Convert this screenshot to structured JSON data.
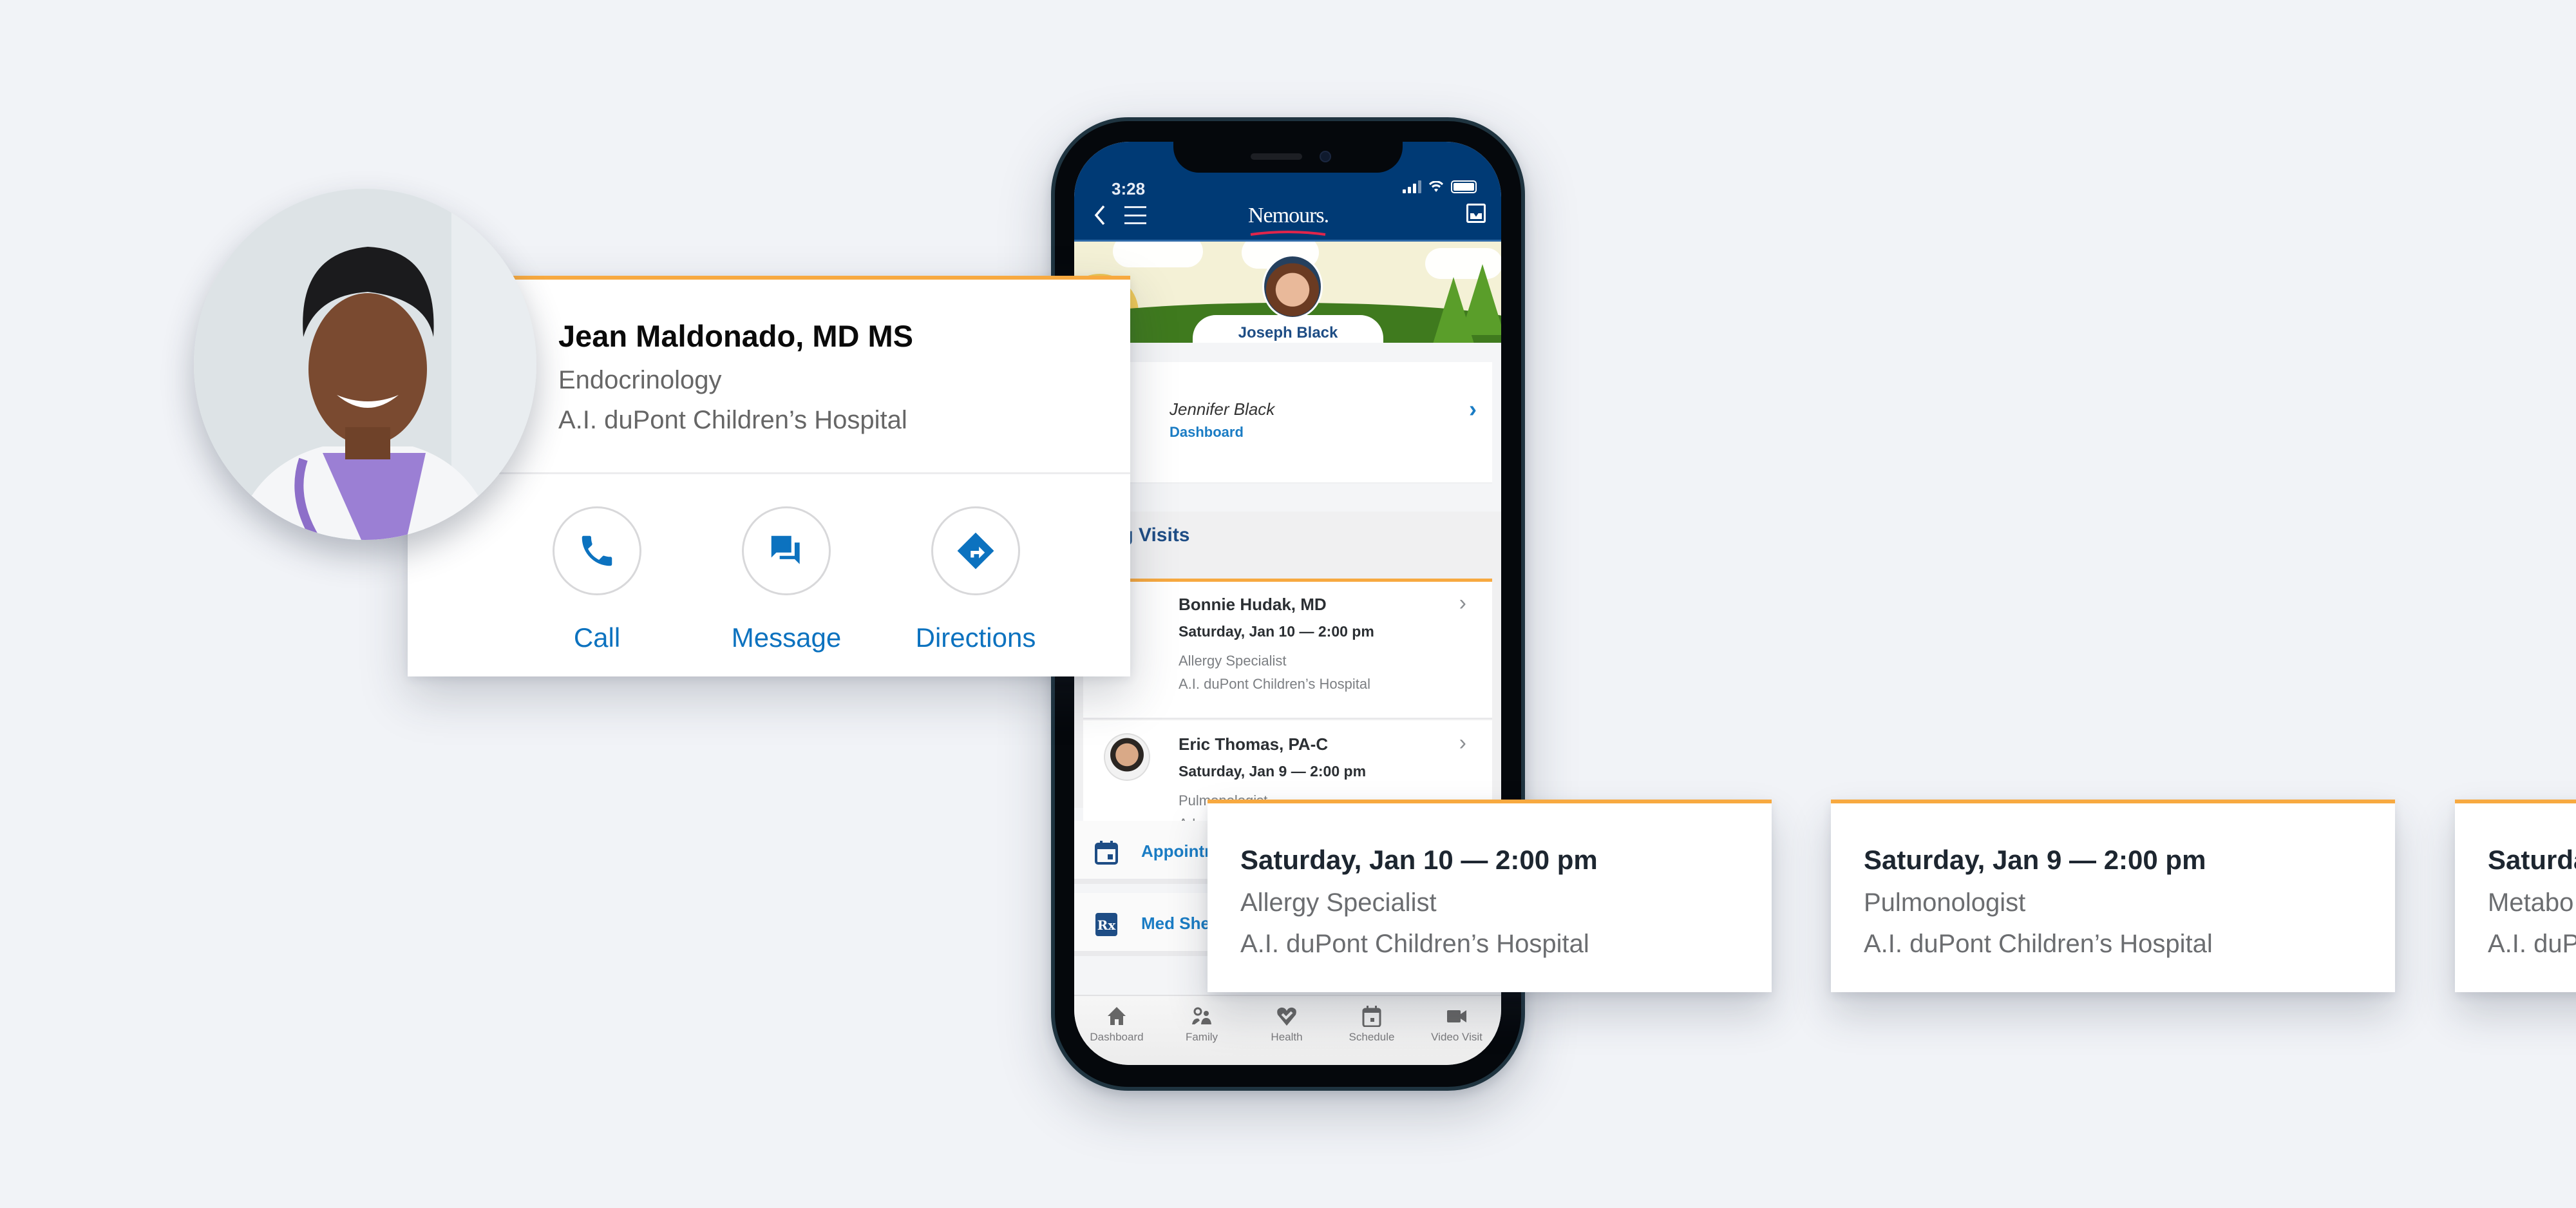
{
  "phone": {
    "status_time": "3:28",
    "header": {
      "back_icon": "chevron-left-icon",
      "menu_icon": "hamburger-menu-icon",
      "logo_text": "Nemours.",
      "inbox_icon": "inbox-icon"
    },
    "profile": {
      "name": "Joseph Black"
    },
    "switch_profile": {
      "name": "Jennifer Black",
      "link": "Dashboard"
    },
    "upcoming_visits": {
      "title": "Upcoming Visits",
      "title_visible": "ming Visits",
      "items": [
        {
          "provider": "Bonnie Hudak, MD",
          "datetime": "Saturday, Jan 10 — 2:00 pm",
          "specialty": "Allergy Specialist",
          "location": "A.I. duPont Children’s Hospital"
        },
        {
          "provider": "Eric Thomas, PA-C",
          "datetime": "Saturday, Jan 9 — 2:00 pm",
          "specialty": "Pulmonologist",
          "location": "A.I. duPont Children’s Hospital"
        }
      ]
    },
    "menu": [
      {
        "label": "Appointm",
        "icon": "calendar-icon"
      },
      {
        "label": "Med Shel",
        "icon": "rx-icon"
      }
    ],
    "bottom_nav": [
      {
        "label": "Dashboard",
        "icon": "home-icon"
      },
      {
        "label": "Family",
        "icon": "family-icon"
      },
      {
        "label": "Health",
        "icon": "heart-check-icon"
      },
      {
        "label": "Schedule",
        "icon": "calendar-icon"
      },
      {
        "label": "Video Visit",
        "icon": "video-camera-icon"
      }
    ]
  },
  "doctor_card": {
    "name": "Jean Maldonado, MD MS",
    "specialty": "Endocrinology",
    "location": "A.I. duPont Children’s Hospital",
    "actions": [
      {
        "label": "Call",
        "icon": "phone-icon"
      },
      {
        "label": "Message",
        "icon": "chat-bubbles-icon"
      },
      {
        "label": "Directions",
        "icon": "directions-icon"
      }
    ]
  },
  "appointment_cards": [
    {
      "datetime": "Saturday, Jan 10 — 2:00 pm",
      "specialty": "Allergy Specialist",
      "location": "A.I. duPont Children’s Hospital"
    },
    {
      "datetime": "Saturday, Jan 9 — 2:00 pm",
      "specialty": "Pulmonologist",
      "location": "A.I. duPont Children’s Hospital"
    },
    {
      "datetime": "Saturda",
      "specialty": "Metabo",
      "location": "A.I. duP"
    }
  ],
  "colors": {
    "brand_navy": "#003a75",
    "accent_orange": "#f7a940",
    "link_blue": "#0c72bf",
    "page_background": "#f1f3f7"
  }
}
